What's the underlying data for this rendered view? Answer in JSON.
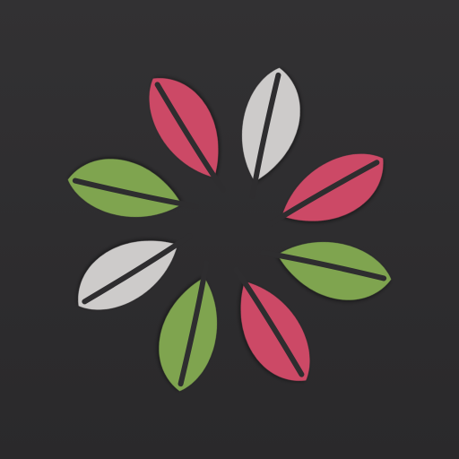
{
  "app_icon": {
    "name": "leaf-flower-logo",
    "background_color": "#2e2d2f",
    "leaf_colors": {
      "pink": "#cc4a66",
      "light": "#cdcbca",
      "green": "#7fa450"
    },
    "leaves": [
      {
        "id": "top-light",
        "color": "light"
      },
      {
        "id": "right-top-pink",
        "color": "pink"
      },
      {
        "id": "right-green",
        "color": "green"
      },
      {
        "id": "bottom-pink",
        "color": "pink"
      },
      {
        "id": "bottom-left-green",
        "color": "green"
      },
      {
        "id": "left-light",
        "color": "light"
      },
      {
        "id": "left-green",
        "color": "green"
      },
      {
        "id": "top-left-pink",
        "color": "pink"
      }
    ]
  }
}
